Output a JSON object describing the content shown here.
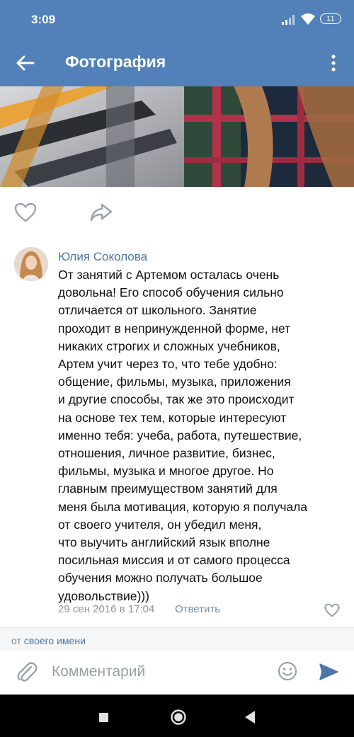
{
  "status_bar": {
    "time": "3:09",
    "battery": "11"
  },
  "app_bar": {
    "title": "Фотография"
  },
  "comment": {
    "author": "Юлия Соколова",
    "text": "От занятий с Артемом осталась очень\nдовольна! Его способ обучения сильно\nотличается от школьного. Занятие\nпроходит в непринужденной форме, нет\nникаких строгих и сложных учебников,\nАртем учит через то, что тебе удобно:\nобщение, фильмы, музыка, приложения\nи другие способы, так же это происходит\nна основе тех тем, которые интересуют\nименно тебя: учеба, работа, путешествие,\nотношения, личное развитие, бизнес,\nфильмы, музыка и многое другое. Но\nглавным преимуществом занятий для\nменя была мотивация, которую я получала\nот своего учителя, он убедил меня,\nчто выучить английский язык вполне\nпосильная миссия и от самого процесса\nобучения можно получать большое\nудовольствие)))",
    "date": "29 сен 2016 в 17:04",
    "reply_label": "Ответить"
  },
  "post_as": {
    "prefix": "от",
    "link": "своего имени"
  },
  "input": {
    "placeholder": "Комментарий"
  },
  "colors": {
    "header": "#5181b8",
    "link": "#4a76a8",
    "icon": "#99a2ad"
  }
}
